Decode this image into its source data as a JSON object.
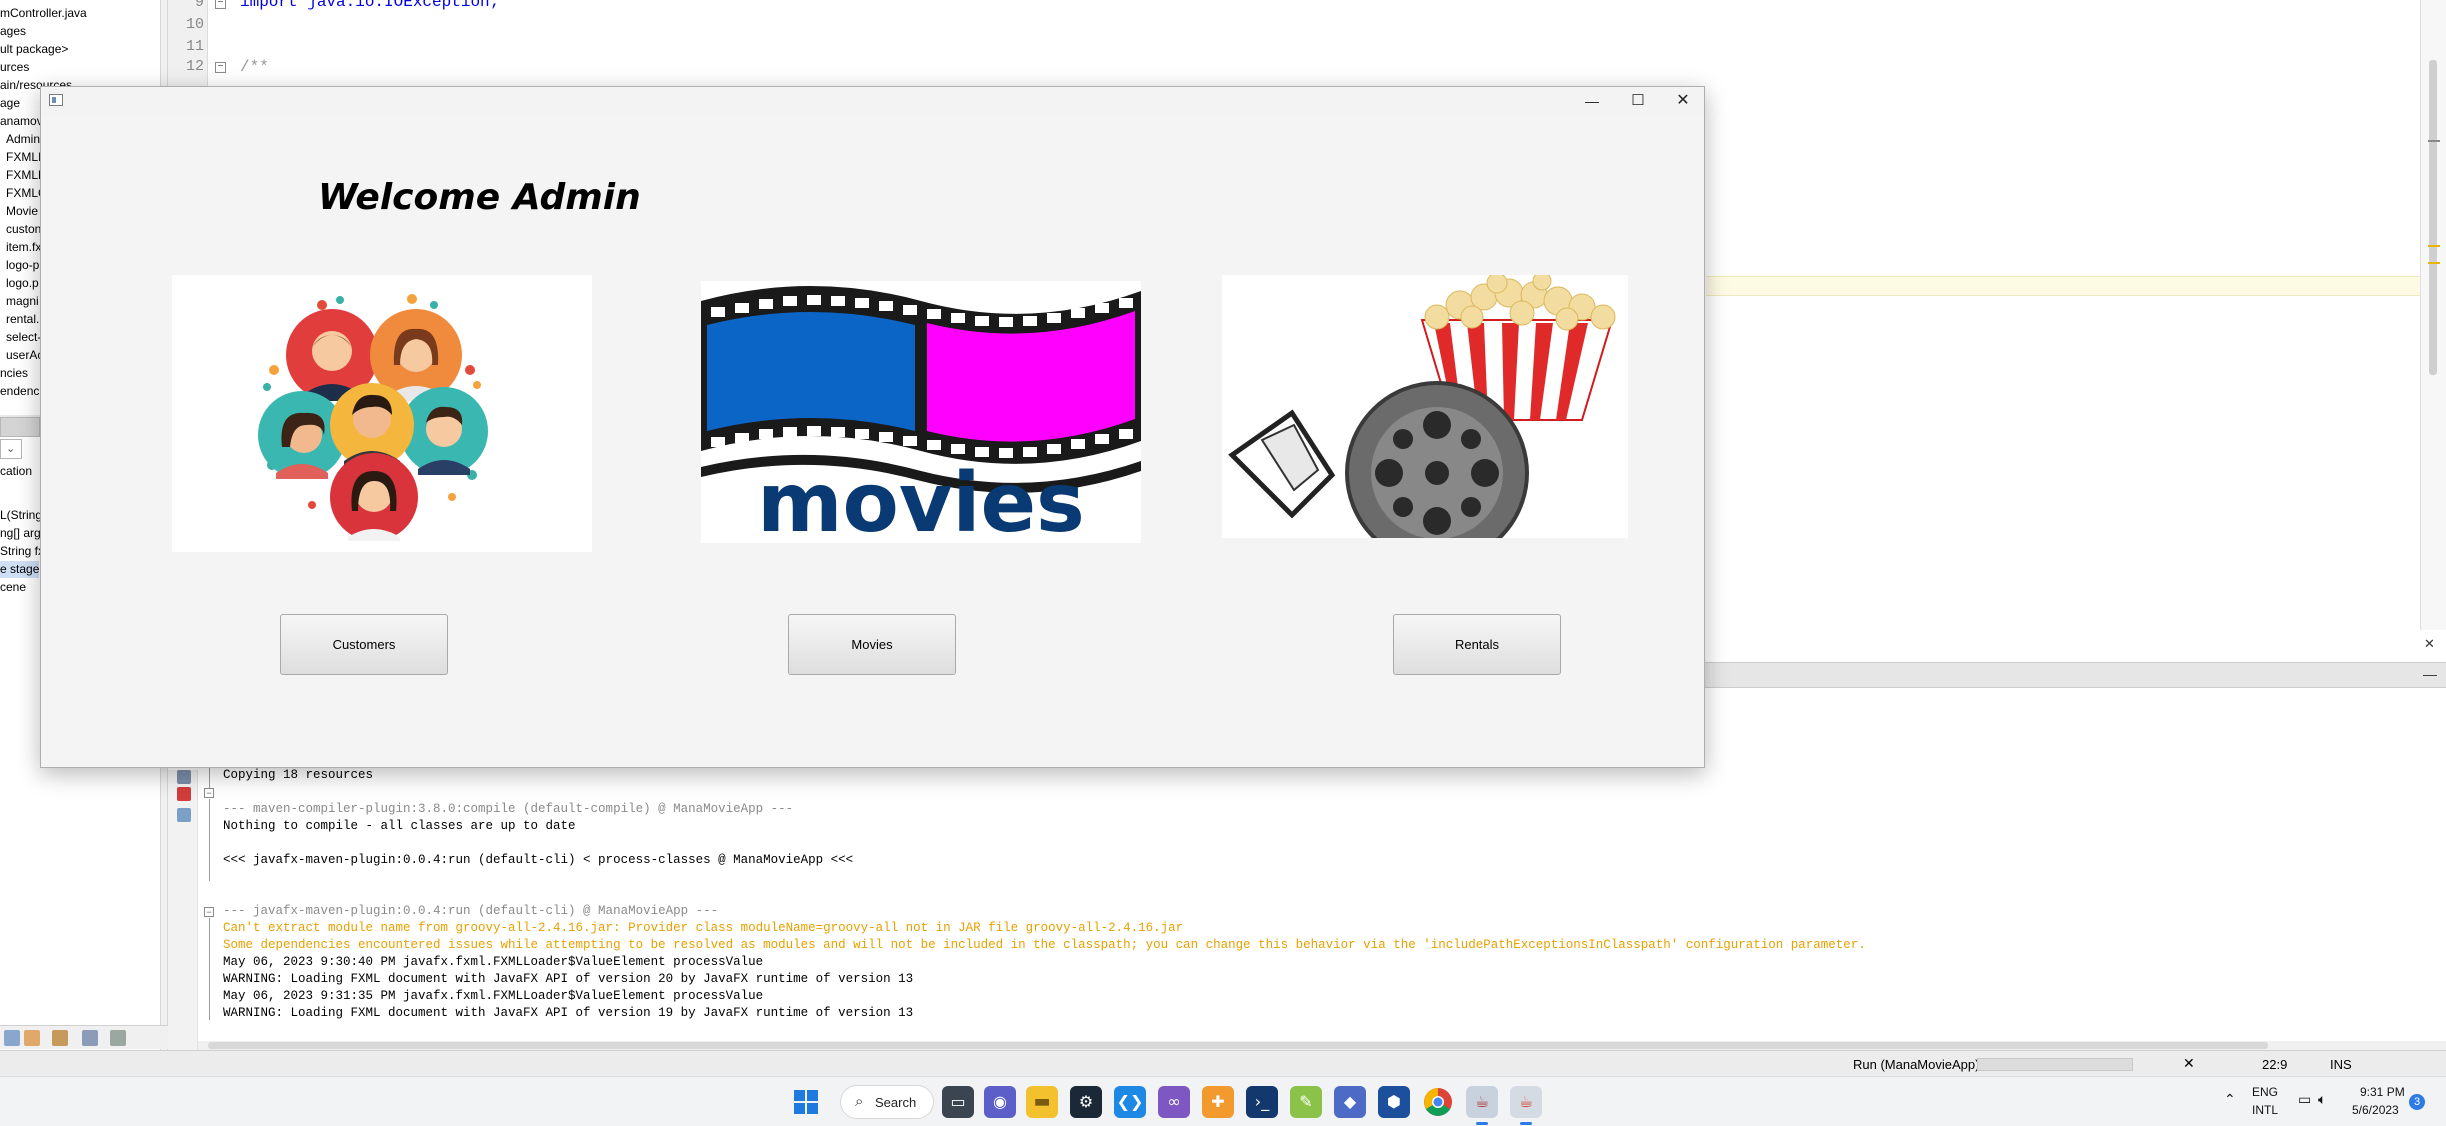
{
  "ide": {
    "project_tree": [
      "mController.java",
      "ages",
      "ult package>",
      "urces",
      "ain/resources",
      "age",
      "anamovi",
      "Admin",
      "FXMLI",
      "FXMLL",
      "FXMLC",
      "Movie",
      "custon",
      "item.fx",
      "logo-p",
      "logo.p",
      "magni",
      "rental.",
      "select-",
      "userAc",
      "ncies",
      "endenci"
    ],
    "navigator_rows": [
      "cation",
      "L(String",
      "ng[] arg",
      "String fx",
      "e stage",
      "cene"
    ],
    "editor_line_numbers": [
      "9",
      "10",
      "11",
      "12"
    ],
    "editor_code_import": "import java.io.IOException;",
    "editor_code_comment": "/**",
    "output_lines": [
      {
        "text": "Copying 18 resources",
        "style": "normal"
      },
      {
        "text": "",
        "style": "normal"
      },
      {
        "text": "--- maven-compiler-plugin:3.8.0:compile (default-compile) @ ManaMovieApp ---",
        "style": "gray"
      },
      {
        "text": "Nothing to compile - all classes are up to date",
        "style": "normal"
      },
      {
        "text": "",
        "style": "normal"
      },
      {
        "text": "<<< javafx-maven-plugin:0.0.4:run (default-cli) < process-classes @ ManaMovieApp <<<",
        "style": "normal"
      },
      {
        "text": "",
        "style": "normal"
      },
      {
        "text": "",
        "style": "normal"
      },
      {
        "text": "--- javafx-maven-plugin:0.0.4:run (default-cli) @ ManaMovieApp ---",
        "style": "gray"
      },
      {
        "text": "Can't extract module name from groovy-all-2.4.16.jar: Provider class moduleName=groovy-all not in JAR file groovy-all-2.4.16.jar",
        "style": "orange"
      },
      {
        "text": "Some dependencies encountered issues while attempting to be resolved as modules and will not be included in the classpath; you can change this behavior via the  'includePathExceptionsInClasspath' configuration parameter.",
        "style": "orange"
      },
      {
        "text": "May 06, 2023 9:30:40 PM javafx.fxml.FXMLLoader$ValueElement processValue",
        "style": "normal"
      },
      {
        "text": "WARNING: Loading FXML document with JavaFX API of version 20 by JavaFX runtime of version 13",
        "style": "normal"
      },
      {
        "text": "May 06, 2023 9:31:35 PM javafx.fxml.FXMLLoader$ValueElement processValue",
        "style": "normal"
      },
      {
        "text": "WARNING: Loading FXML document with JavaFX API of version 19 by JavaFX runtime of version 13",
        "style": "normal"
      }
    ],
    "status": {
      "run_label": "Run (ManaMovieApp)",
      "close_glyph": "✕",
      "caret_position": "22:9",
      "insert_mode": "INS"
    }
  },
  "app_window": {
    "controls": {
      "minimize": "—",
      "maximize": "☐",
      "close": "✕"
    },
    "welcome_title": "Welcome Admin",
    "cards": {
      "customers_image": "people-group-illustration",
      "movies_image": "film-strip-movies-logo",
      "movies_logo_text": "movies",
      "rentals_image": "popcorn-and-film-reel"
    },
    "buttons": {
      "customers": "Customers",
      "movies": "Movies",
      "rentals": "Rentals"
    }
  },
  "taskbar": {
    "search_label": "Search",
    "apps": [
      "windows-start",
      "search",
      "task-view",
      "teams-chat",
      "file-explorer",
      "steam",
      "vscode",
      "visual-studio",
      "app-orange",
      "powershell",
      "notepad-plus-plus",
      "game-controller",
      "virtualbox",
      "chrome",
      "netbeans",
      "java-app"
    ],
    "tray": {
      "language": "ENG",
      "layout": "INTL",
      "time": "9:31 PM",
      "date": "5/6/2023",
      "notifications": "3"
    }
  },
  "colors": {
    "accent": "#2e7be6",
    "warning_text": "#e8a000",
    "keyword_blue": "#0000e6",
    "film_blue": "#0b65c7",
    "film_magenta": "#ff00ff",
    "movies_navy": "#0a3a73",
    "popcorn_red": "#e02a2a"
  }
}
